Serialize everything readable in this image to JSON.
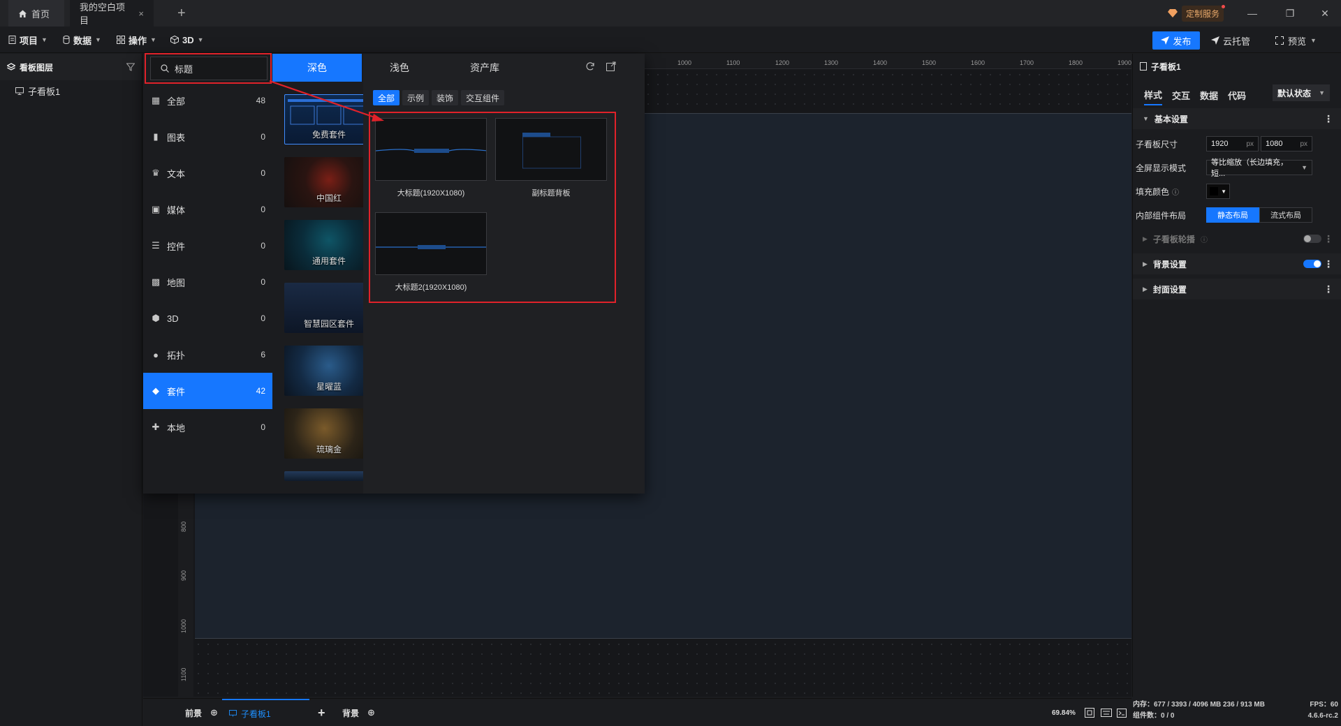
{
  "tabs": {
    "home": "首页",
    "project": "我的空白项目",
    "close": "×",
    "add": "+"
  },
  "custom_service": "定制服务",
  "toolbar": {
    "project": "项目",
    "data": "数据",
    "operate": "操作",
    "threed": "3D",
    "publish": "发布",
    "cloud": "云托管",
    "preview": "预览"
  },
  "layers": {
    "title": "看板图层",
    "items": [
      "子看板1"
    ]
  },
  "popup": {
    "search_value": "标题",
    "categories": [
      {
        "label": "全部",
        "count": "48",
        "icon": "grid-icon"
      },
      {
        "label": "图表",
        "count": "0",
        "icon": "bar-chart-icon"
      },
      {
        "label": "文本",
        "count": "0",
        "icon": "text-icon"
      },
      {
        "label": "媒体",
        "count": "0",
        "icon": "media-icon"
      },
      {
        "label": "控件",
        "count": "0",
        "icon": "control-icon"
      },
      {
        "label": "地图",
        "count": "0",
        "icon": "map-icon"
      },
      {
        "label": "3D",
        "count": "0",
        "icon": "cube-icon"
      },
      {
        "label": "拓扑",
        "count": "6",
        "icon": "topology-icon"
      },
      {
        "label": "套件",
        "count": "42",
        "icon": "kit-icon"
      },
      {
        "label": "本地",
        "count": "0",
        "icon": "puzzle-icon"
      }
    ],
    "theme_tabs": {
      "dark": "深色",
      "light": "浅色",
      "assets": "资产库"
    },
    "kits": [
      "免费套件",
      "中国红",
      "通用套件",
      "智慧园区套件",
      "星曜蓝",
      "琉璃金"
    ],
    "filters": [
      "全部",
      "示例",
      "装饰",
      "交互组件"
    ],
    "results": [
      "大标题(1920X1080)",
      "副标题背板",
      "大标题2(1920X1080)"
    ]
  },
  "ruler_top": [
    "1000",
    "1100",
    "1200",
    "1300",
    "1400",
    "1500",
    "1600",
    "1700",
    "1800",
    "1900"
  ],
  "ruler_left": [
    "800",
    "900",
    "1000",
    "1100"
  ],
  "bottom": {
    "front": "前景",
    "board_tab": "子看板1",
    "add": "+",
    "back": "背景",
    "zoom": "69.84%"
  },
  "props": {
    "title": "子看板1",
    "tabs": [
      "样式",
      "交互",
      "数据",
      "代码"
    ],
    "state": "默认状态",
    "basic": "基本设置",
    "size_label": "子看板尺寸",
    "width": "1920",
    "height": "1080",
    "unit": "px",
    "fullscreen_label": "全屏显示模式",
    "fullscreen_value": "等比缩放（长边填充，短...",
    "fill_label": "填充颜色",
    "layout_label": "内部组件布局",
    "layout_static": "静态布局",
    "layout_flow": "流式布局",
    "carousel": "子看板轮播",
    "background": "背景设置",
    "cover": "封面设置",
    "colors": {
      "accent": "#1677ff",
      "highlight": "#e0222a"
    }
  },
  "status": {
    "memory": "内存：677 / 3393 / 4096 MB  236 / 913 MB",
    "components": "组件数：0 / 0",
    "fps": "FPS：60",
    "version": "4.6.6-rc.2"
  }
}
